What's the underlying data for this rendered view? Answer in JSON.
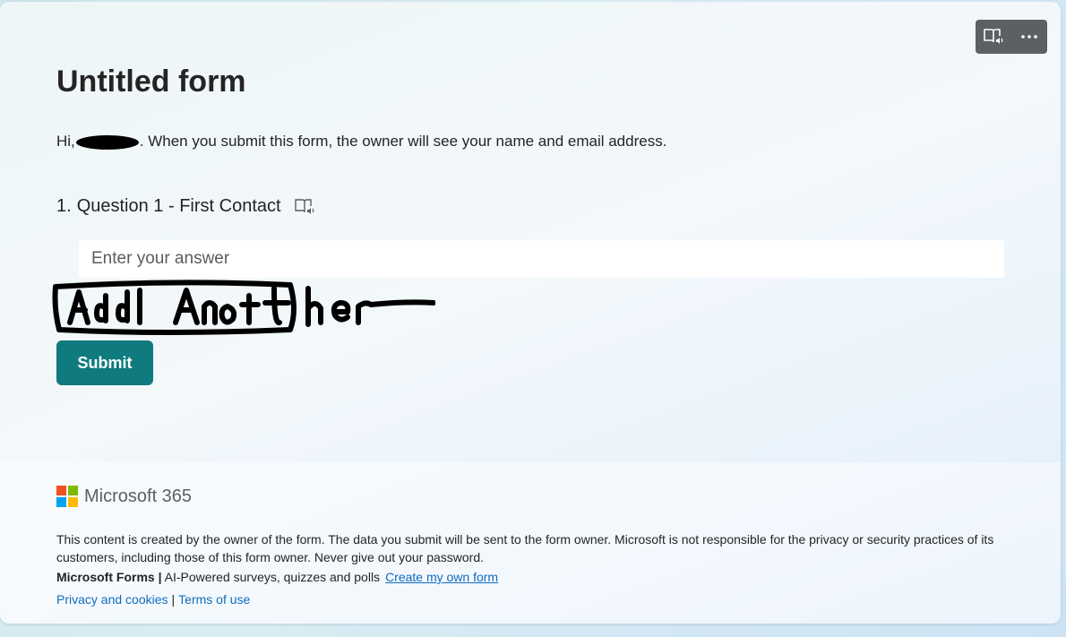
{
  "form": {
    "title": "Untitled form",
    "notice_prefix": "Hi,",
    "notice_suffix": ". When you submit this form, the owner will see your name and email address."
  },
  "question": {
    "number": "1.",
    "text": "Question 1 - First Contact",
    "answer_placeholder": "Enter your answer",
    "answer_value": ""
  },
  "handwritten_annotation": "Add Another",
  "submit_label": "Submit",
  "footer": {
    "brand": "Microsoft 365",
    "disclaimer": "This content is created by the owner of the form. The data you submit will be sent to the form owner. Microsoft is not responsible for the privacy or security practices of its customers, including those of this form owner. Never give out your password.",
    "product": "Microsoft Forms |",
    "tagline": " AI-Powered surveys, quizzes and polls",
    "create_link": "Create my own form",
    "privacy_link": "Privacy and cookies",
    "separator": "|",
    "terms_link": "Terms of use"
  },
  "icons": {
    "topbar": [
      "immersive-reader-icon",
      "more-options-icon"
    ],
    "question": "immersive-reader-icon"
  },
  "colors": {
    "accent": "#0f7b7e",
    "link": "#0f6cbd",
    "logo": [
      "#f25022",
      "#7fba00",
      "#00a4ef",
      "#ffb900"
    ]
  }
}
